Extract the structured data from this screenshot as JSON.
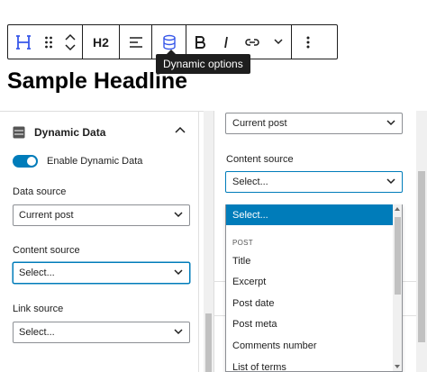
{
  "toolbar": {
    "heading_level": "H2",
    "tooltip": "Dynamic options"
  },
  "editor": {
    "headline": "Sample Headline"
  },
  "left_panel": {
    "title": "Dynamic Data",
    "toggle_label": "Enable Dynamic Data",
    "toggle_on": true,
    "data_source_label": "Data source",
    "data_source_value": "Current post",
    "content_source_label": "Content source",
    "content_source_value": "Select...",
    "link_source_label": "Link source",
    "link_source_value": "Select..."
  },
  "right_panel": {
    "data_source_value": "Current post",
    "content_source_label": "Content source",
    "content_source_value": "Select...",
    "dropdown": {
      "selected": "Select...",
      "group_label": "POST",
      "options": [
        "Title",
        "Excerpt",
        "Post date",
        "Post meta",
        "Comments number",
        "List of terms"
      ]
    }
  },
  "colors": {
    "accent": "#007cba",
    "text": "#1e1e1e",
    "border": "#8c8f94"
  },
  "icons": [
    "heading-block-icon",
    "drag-handle-icon",
    "move-up-icon",
    "move-down-icon",
    "align-left-icon",
    "database-icon",
    "bold-icon",
    "italic-icon",
    "link-icon",
    "chevron-down-icon",
    "more-options-icon",
    "chevron-up-icon"
  ]
}
